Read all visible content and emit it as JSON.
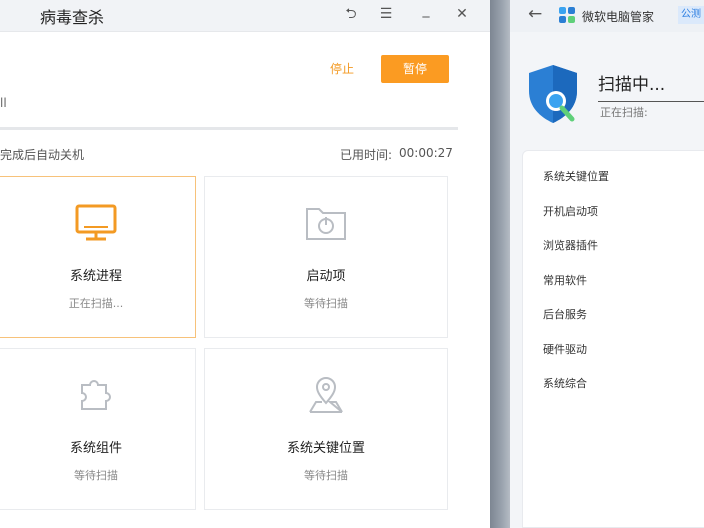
{
  "left_window": {
    "title": "病毒查杀",
    "controls": {
      "back": "⮌",
      "menu": "☰",
      "minimize": "_",
      "close": "✕"
    },
    "stop_label": "停止",
    "pause_label": "暂停",
    "clip_text": "ll",
    "autoshutdown_text": "完成后自动关机",
    "elapsed_label": "已用时间:",
    "elapsed_value": "00:00:27",
    "progress_fraction": 0.0,
    "cards": [
      {
        "title": "系统进程",
        "status": "正在扫描...",
        "icon": "monitor-icon",
        "active": true
      },
      {
        "title": "启动项",
        "status": "等待扫描",
        "icon": "startup-folder-icon",
        "active": false
      },
      {
        "title": "系统组件",
        "status": "等待扫描",
        "icon": "puzzle-icon",
        "active": false
      },
      {
        "title": "系统关键位置",
        "status": "等待扫描",
        "icon": "location-pin-icon",
        "active": false
      }
    ]
  },
  "right_window": {
    "brand_name": "微软电脑管家",
    "beta_badge": "公测",
    "scanning_title": "扫描中...",
    "scanning_path": "正在扫描:",
    "list_items": [
      "系统关键位置",
      "开机启动项",
      "浏览器插件",
      "常用软件",
      "后台服务",
      "硬件驱动",
      "系统综合"
    ]
  },
  "colors": {
    "accent_orange": "#fb9b22",
    "active_border": "#f7c27a",
    "shield_blue": "#2b7fd4",
    "brand_blue": "#2a7de1"
  }
}
